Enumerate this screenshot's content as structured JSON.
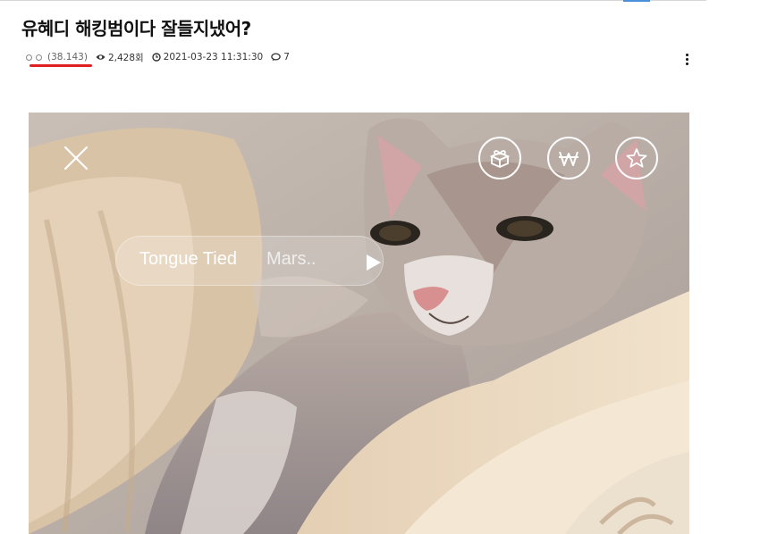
{
  "post": {
    "title": "유혜디 해킹범이다 잘들지냈어?",
    "author_score": "(38.143)",
    "views": "2,428회",
    "datetime": "2021-03-23 11:31:30",
    "comments": "7"
  },
  "media": {
    "song_title": "Tongue Tied",
    "song_artist": "Mars.."
  },
  "colors": {
    "underline": "#e02020",
    "text": "#111111",
    "meta": "#333333"
  },
  "icons": [
    "eye-icon",
    "clock-icon",
    "comment-icon",
    "more-vertical-icon",
    "close-icon",
    "gift-icon",
    "won-icon",
    "star-icon",
    "play-icon"
  ]
}
